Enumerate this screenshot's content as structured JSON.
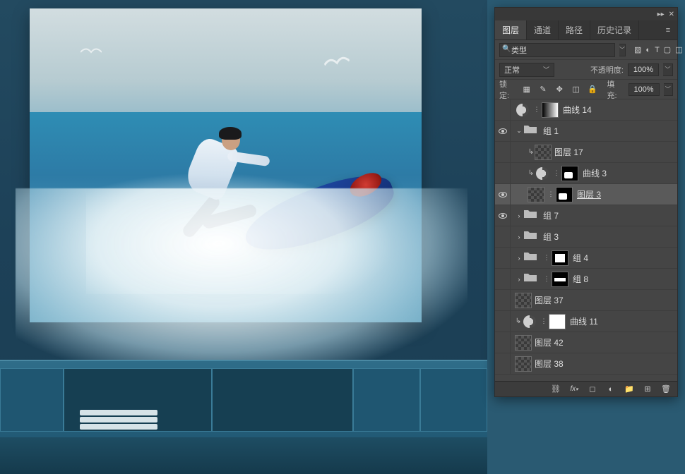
{
  "panel": {
    "tabs": [
      "图层",
      "通道",
      "路径",
      "历史记录"
    ],
    "active_tab": 0,
    "filter": {
      "search_value": "类型",
      "icons": [
        "image-filter-icon",
        "adjust-filter-icon",
        "text-filter-icon",
        "shape-filter-icon",
        "smart-filter-icon"
      ]
    },
    "blend_mode": {
      "value": "正常"
    },
    "opacity": {
      "label": "不透明度:",
      "value": "100%"
    },
    "lock": {
      "label": "锁定:",
      "fill_label": "填充:",
      "value": "100%"
    },
    "lock_icons": [
      "lock-transparent-icon",
      "lock-brush-icon",
      "lock-position-icon",
      "lock-artboard-icon",
      "lock-all-icon"
    ]
  },
  "layers": [
    {
      "visible": false,
      "indent": 0,
      "clip": false,
      "type": "adjust",
      "mask": "grad",
      "name": "曲线 14"
    },
    {
      "visible": true,
      "indent": 0,
      "clip": false,
      "type": "group",
      "expanded": true,
      "name": "组 1"
    },
    {
      "visible": false,
      "indent": 1,
      "clip": true,
      "type": "pixel",
      "mask": null,
      "name": "图层 17"
    },
    {
      "visible": false,
      "indent": 1,
      "clip": true,
      "type": "adjust",
      "mask": "shape3",
      "name": "曲线 3"
    },
    {
      "visible": true,
      "indent": 1,
      "clip": false,
      "type": "pixel",
      "mask": "shape3",
      "name": "图层 3",
      "selected": true
    },
    {
      "visible": true,
      "indent": 0,
      "clip": false,
      "type": "group",
      "expanded": false,
      "name": "组 7"
    },
    {
      "visible": false,
      "indent": 0,
      "clip": false,
      "type": "group",
      "expanded": false,
      "name": "组 3"
    },
    {
      "visible": false,
      "indent": 0,
      "clip": false,
      "type": "group_masked",
      "mask": "shape1",
      "expanded": false,
      "name": "组 4"
    },
    {
      "visible": false,
      "indent": 0,
      "clip": false,
      "type": "group_masked",
      "mask": "shape2",
      "expanded": false,
      "name": "组 8"
    },
    {
      "visible": false,
      "indent": 0,
      "clip": false,
      "type": "pixel",
      "mask": null,
      "name": "图层 37"
    },
    {
      "visible": false,
      "indent": 0,
      "clip": true,
      "type": "adjust",
      "mask": "white",
      "name": "曲线 11"
    },
    {
      "visible": false,
      "indent": 0,
      "clip": false,
      "type": "pixel",
      "mask": null,
      "name": "图层 42"
    },
    {
      "visible": false,
      "indent": 0,
      "clip": false,
      "type": "pixel",
      "mask": null,
      "name": "图层 38"
    }
  ],
  "footer_icons": [
    "link-icon",
    "fx-icon",
    "mask-icon",
    "adjustment-icon",
    "group-icon",
    "new-layer-icon",
    "trash-icon"
  ]
}
